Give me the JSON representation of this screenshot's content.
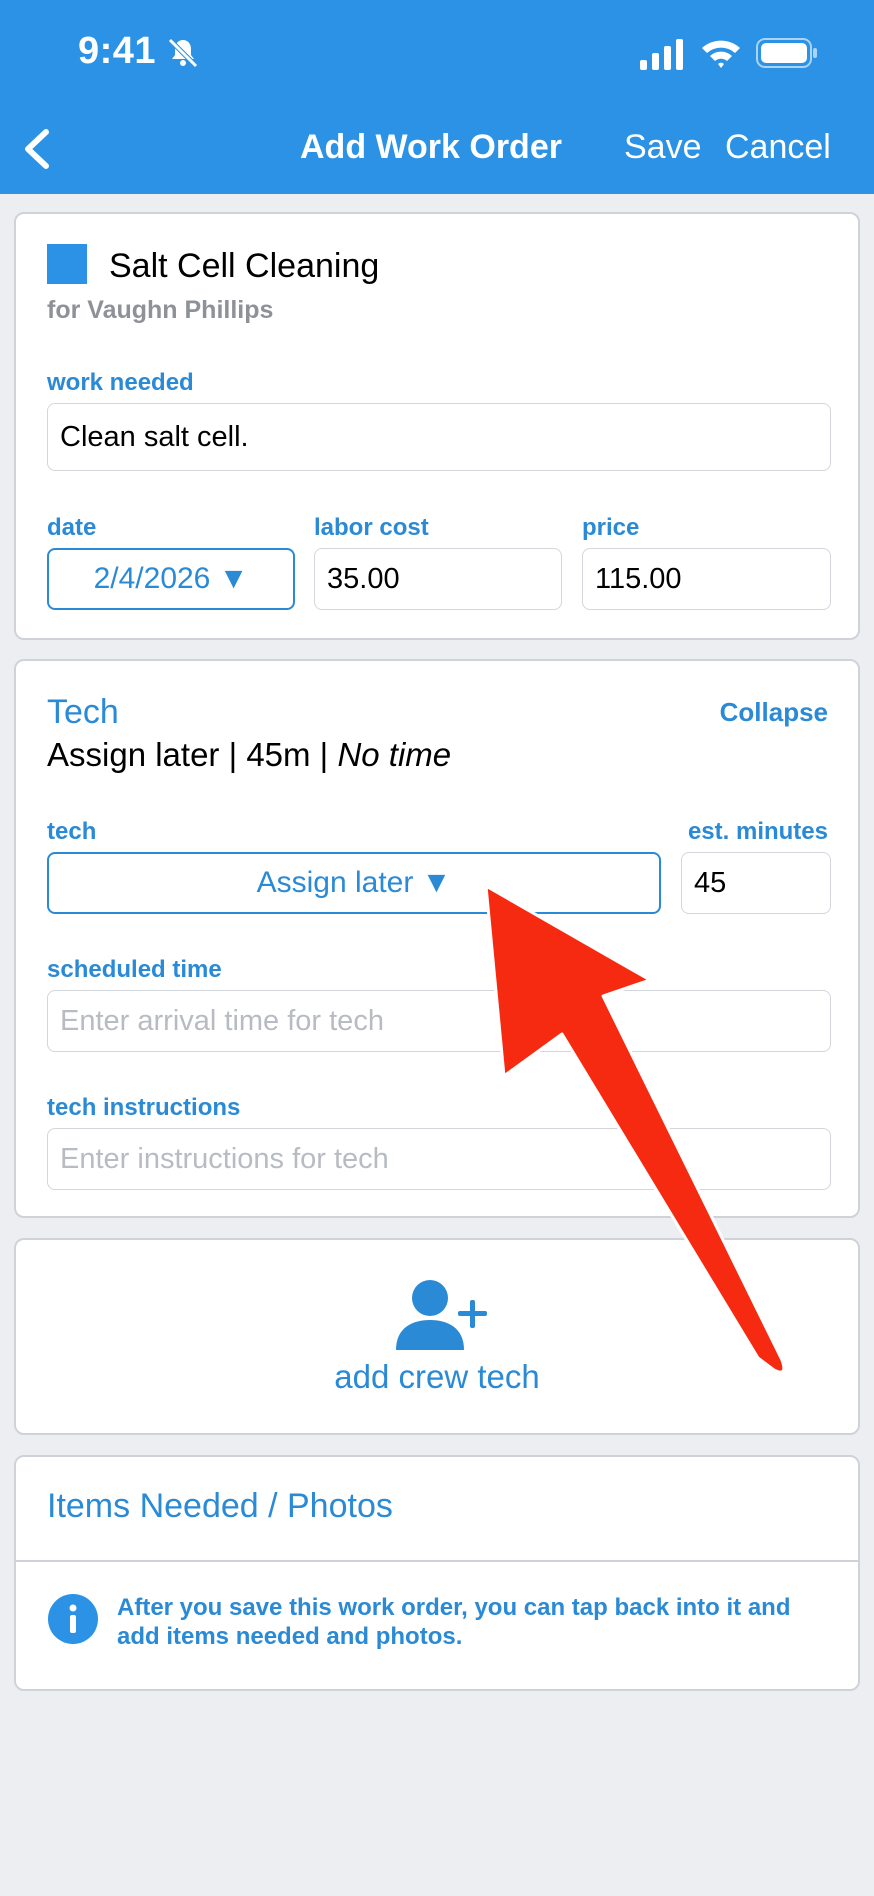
{
  "status_bar": {
    "time": "9:41"
  },
  "nav": {
    "title": "Add Work Order",
    "save": "Save",
    "cancel": "Cancel"
  },
  "work_order": {
    "title": "Salt Cell Cleaning",
    "customer": "for Vaughn Phillips",
    "color": "#2b92e6",
    "work_needed_label": "work needed",
    "work_needed_value": "Clean salt cell.",
    "date_label": "date",
    "date_value": "2/4/2026 ▼",
    "labor_cost_label": "labor cost",
    "labor_cost_value": "35.00",
    "price_label": "price",
    "price_value": "115.00"
  },
  "tech": {
    "heading": "Tech",
    "collapse": "Collapse",
    "summary_main": "Assign later | 45m | ",
    "summary_italic": "No time",
    "tech_label": "tech",
    "tech_value": "Assign later ▼",
    "est_label": "est. minutes",
    "est_value": "45",
    "scheduled_label": "scheduled time",
    "scheduled_placeholder": "Enter arrival time for tech",
    "instructions_label": "tech instructions",
    "instructions_placeholder": "Enter instructions for tech"
  },
  "add_crew": {
    "label": "add crew tech"
  },
  "items": {
    "heading": "Items Needed / Photos",
    "info": "After you save this work order, you can tap back into it and add items needed and photos."
  },
  "colors": {
    "accent": "#2b8ad6",
    "header": "#2b92e6",
    "arrow": "#f62a10"
  }
}
